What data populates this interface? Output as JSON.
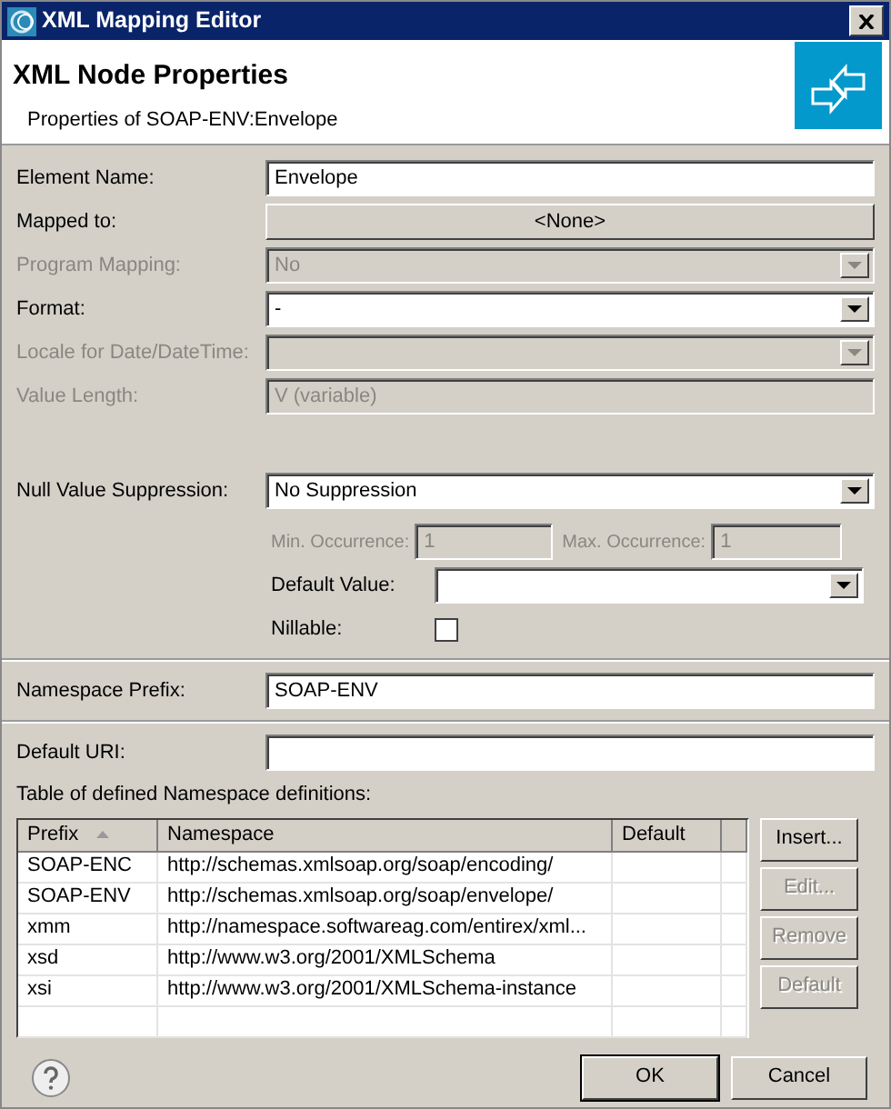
{
  "window": {
    "title": "XML Mapping Editor"
  },
  "header": {
    "title": "XML Node Properties",
    "subtitle": "Properties of SOAP-ENV:Envelope"
  },
  "fields": [
    {
      "kind": "text",
      "label": "Element Name:",
      "value": "Envelope",
      "disabled": false
    },
    {
      "kind": "button",
      "label": "Mapped to:",
      "value": "<None>",
      "disabled": false
    },
    {
      "kind": "select",
      "label": "Program Mapping:",
      "value": "No",
      "disabled": true
    },
    {
      "kind": "select",
      "label": "Format:",
      "value": "-",
      "disabled": false
    },
    {
      "kind": "select",
      "label": "Locale for Date/DateTime:",
      "disabled": true
    },
    {
      "kind": "text",
      "label": "Value Length:",
      "value": "V (variable)",
      "disabled": true
    }
  ],
  "null_suppression": {
    "label": "Null Value Suppression:",
    "value": "No Suppression"
  },
  "occurrence": [
    {
      "label": "Min. Occurrence:",
      "value": "1",
      "disabled": true
    },
    {
      "label": "Max. Occurrence:",
      "value": "1",
      "disabled": true
    }
  ],
  "default_value": {
    "label": "Default Value:"
  },
  "nillable": {
    "label": "Nillable:",
    "checked": false
  },
  "namespace_prefix": {
    "label": "Namespace Prefix:",
    "value": "SOAP-ENV"
  },
  "default_uri": {
    "label": "Default URI:"
  },
  "table": {
    "caption": "Table of defined Namespace definitions:",
    "columns": [
      {
        "label": "Prefix",
        "sorted": true
      },
      {
        "label": "Namespace",
        "sorted": false
      },
      {
        "label": "Default",
        "sorted": false
      }
    ],
    "rows": [
      {
        "prefix": "SOAP-ENC",
        "namespace": "http://schemas.xmlsoap.org/soap/encoding/"
      },
      {
        "prefix": "SOAP-ENV",
        "namespace": "http://schemas.xmlsoap.org/soap/envelope/"
      },
      {
        "prefix": "xmm",
        "namespace": "http://namespace.softwareag.com/entirex/xml..."
      },
      {
        "prefix": "xsd",
        "namespace": "http://www.w3.org/2001/XMLSchema"
      },
      {
        "prefix": "xsi",
        "namespace": "http://www.w3.org/2001/XMLSchema-instance"
      }
    ]
  },
  "table_buttons": [
    {
      "label": "Insert...",
      "disabled": false
    },
    {
      "label": "Edit...",
      "disabled": true
    },
    {
      "label": "Remove",
      "disabled": true
    },
    {
      "label": "Default",
      "disabled": true
    }
  ],
  "buttons": [
    {
      "label": "OK",
      "default": true
    },
    {
      "label": "Cancel",
      "default": false
    }
  ]
}
